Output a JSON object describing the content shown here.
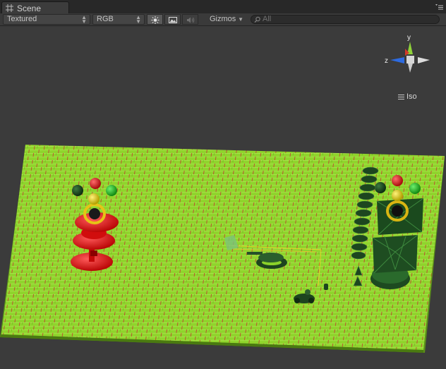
{
  "tab": {
    "title": "Scene",
    "icon": "scene-grid-icon"
  },
  "toolbar": {
    "render_mode": "Textured",
    "color_mode": "RGB",
    "lighting_toggle": "sun-icon",
    "fx_toggle": "image-icon",
    "audio_toggle": "speaker-icon",
    "gizmos_label": "Gizmos",
    "search_placeholder": "All"
  },
  "view_gizmo": {
    "axis_y": "y",
    "axis_z": "z",
    "projection_label": "Iso",
    "colors": {
      "y": "#8fd23a",
      "z": "#2d6be0",
      "x": "#d23a2a"
    }
  },
  "scene": {
    "ground_color": "#8bd12a",
    "grid_line_color": "#c43030",
    "red_tower_color": "#e81414",
    "dark_green_color": "#1f4a24",
    "ball_colors": [
      "#d21616",
      "#2fb52f",
      "#1b5b20",
      "#e6d416"
    ]
  }
}
